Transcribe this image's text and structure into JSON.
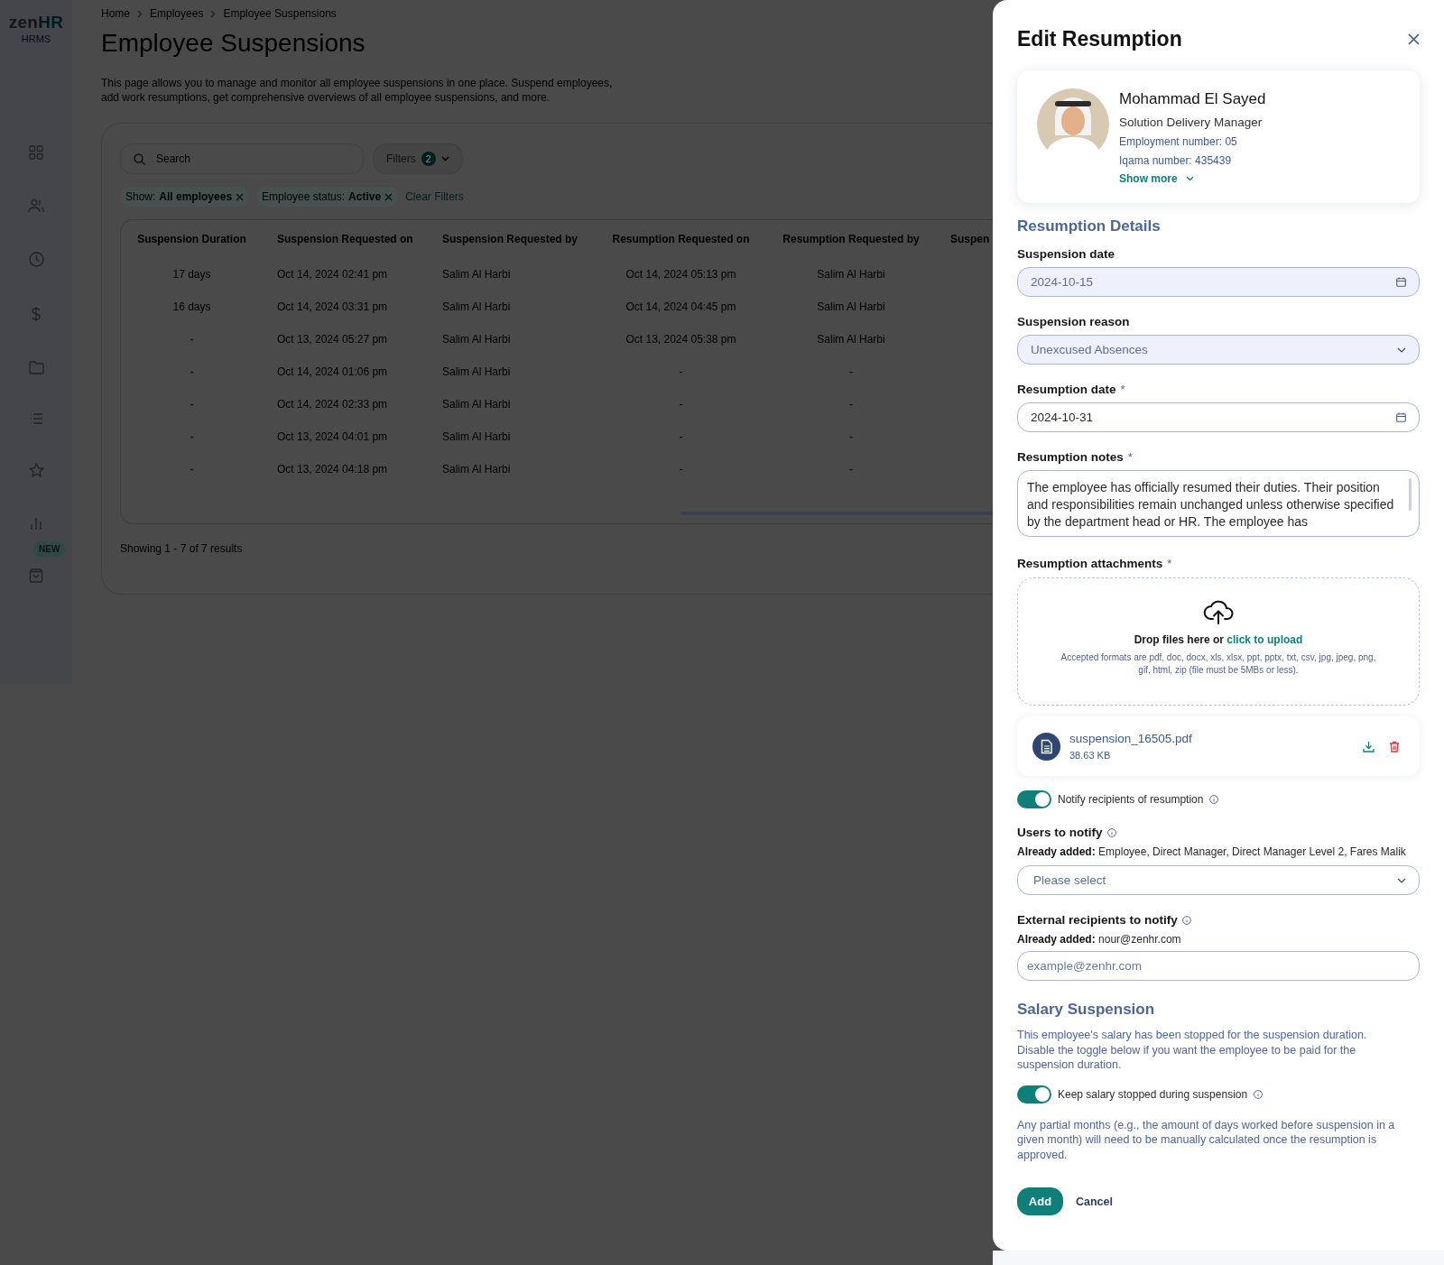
{
  "sidebar": {
    "logo": "zen",
    "logo_accent": "HR",
    "product": "HRMS",
    "new_badge": "NEW"
  },
  "breadcrumb": [
    "Home",
    "Employees",
    "Employee Suspensions"
  ],
  "page": {
    "title": "Employee Suspensions",
    "description": "This page allows you to manage and monitor all employee suspensions in one place. Suspend employees, add work resumptions, get comprehensive overviews of all employee suspensions, and more."
  },
  "search": {
    "placeholder": "Search"
  },
  "filters": {
    "label": "Filters",
    "count": "2"
  },
  "chips": [
    "Show: **All employees**",
    "Employee status: **Active**"
  ],
  "clear_filters": "Clear Filters",
  "table": {
    "columns": [
      "Suspension Duration",
      "Suspension Requested on",
      "Suspension Requested by",
      "Resumption Requested on",
      "Resumption Requested by",
      "Suspen"
    ],
    "rows": [
      [
        "17 days",
        "Oct 14, 2024 02:41 pm",
        "Salim Al Harbi",
        "Oct 14, 2024 05:13 pm",
        "Salim Al Harbi"
      ],
      [
        "16 days",
        "Oct 14, 2024 03:31 pm",
        "Salim Al Harbi",
        "Oct 14, 2024 04:45 pm",
        "Salim Al Harbi"
      ],
      [
        "-",
        "Oct 13, 2024 05:27 pm",
        "Salim Al Harbi",
        "Oct 13, 2024 05:38 pm",
        "Salim Al Harbi"
      ],
      [
        "-",
        "Oct 14, 2024 01:06 pm",
        "Salim Al Harbi",
        "-",
        "-"
      ],
      [
        "-",
        "Oct 14, 2024 02:33 pm",
        "Salim Al Harbi",
        "-",
        "-"
      ],
      [
        "-",
        "Oct 13, 2024 04:01 pm",
        "Salim Al Harbi",
        "-",
        "-"
      ],
      [
        "-",
        "Oct 13, 2024 04:18 pm",
        "Salim Al Harbi",
        "-",
        "-"
      ]
    ]
  },
  "results": "Showing 1 - 7 of 7 results",
  "drawer": {
    "title": "Edit Resumption",
    "employee": {
      "name": "Mohammad El Sayed",
      "position": "Solution Delivery Manager",
      "employment_number": "Employment number: 05",
      "iqama_number": "Iqama number: 435439",
      "show_more": "Show more"
    },
    "details_heading": "Resumption Details",
    "fields": [
      {
        "kind": "date",
        "label": "Suspension date",
        "value": "2024-10-15",
        "disabled": true
      },
      {
        "kind": "select",
        "label": "Suspension reason",
        "value": "Unexcused Absences",
        "disabled": true
      },
      {
        "kind": "date",
        "label": "Resumption date",
        "required_mark": "*",
        "value": "2024-10-31",
        "disabled": false
      },
      {
        "kind": "textarea",
        "label": "Resumption notes",
        "required_mark": "*",
        "value": "The employee has officially resumed their duties. Their position and responsibilities remain unchanged unless otherwise specified by the department head or HR. The employee has",
        "disabled": false
      }
    ],
    "attachments": {
      "label": "Resumption attachments",
      "required_mark": "*",
      "drop_text": "Drop files here or",
      "upload_link": "click to upload",
      "formats": "Accepted formats are pdf, doc, docx, xls, xlsx, ppt, pptx, txt, csv, jpg, jpeg, png, gif, html, zip (file must be 5MBs or less).",
      "files": [
        {
          "name": "suspension_16505.pdf",
          "size": "38.63 KB"
        }
      ]
    },
    "notify_toggle": {
      "label": "Notify recipients of resumption",
      "on": true
    },
    "users_to_notify": {
      "label": "Users to notify",
      "already_added": "**Already added:** Employee, Direct Manager, Direct Manager Level 2, Fares Malik",
      "placeholder": "Please select"
    },
    "external_recipients": {
      "label": "External recipients to notify",
      "already_added": "**Already added:** nour@zenhr.com",
      "placeholder": "example@zenhr.com"
    },
    "salary_heading": "Salary Suspension",
    "salary_text": "This employee's salary has been stopped for the suspension duration. Disable the toggle below if you want the employee to be paid for the suspension duration.",
    "salary_toggle": {
      "label": "Keep salary stopped during suspension",
      "on": true
    },
    "partial_note": "Any partial months (e.g., the amount of days worked before suspension in a given month) will need to be manually calculated once the resumption is approved.",
    "buttons": [
      {
        "kind": "primary",
        "label": "Add"
      },
      {
        "kind": "text",
        "label": "Cancel"
      }
    ]
  }
}
